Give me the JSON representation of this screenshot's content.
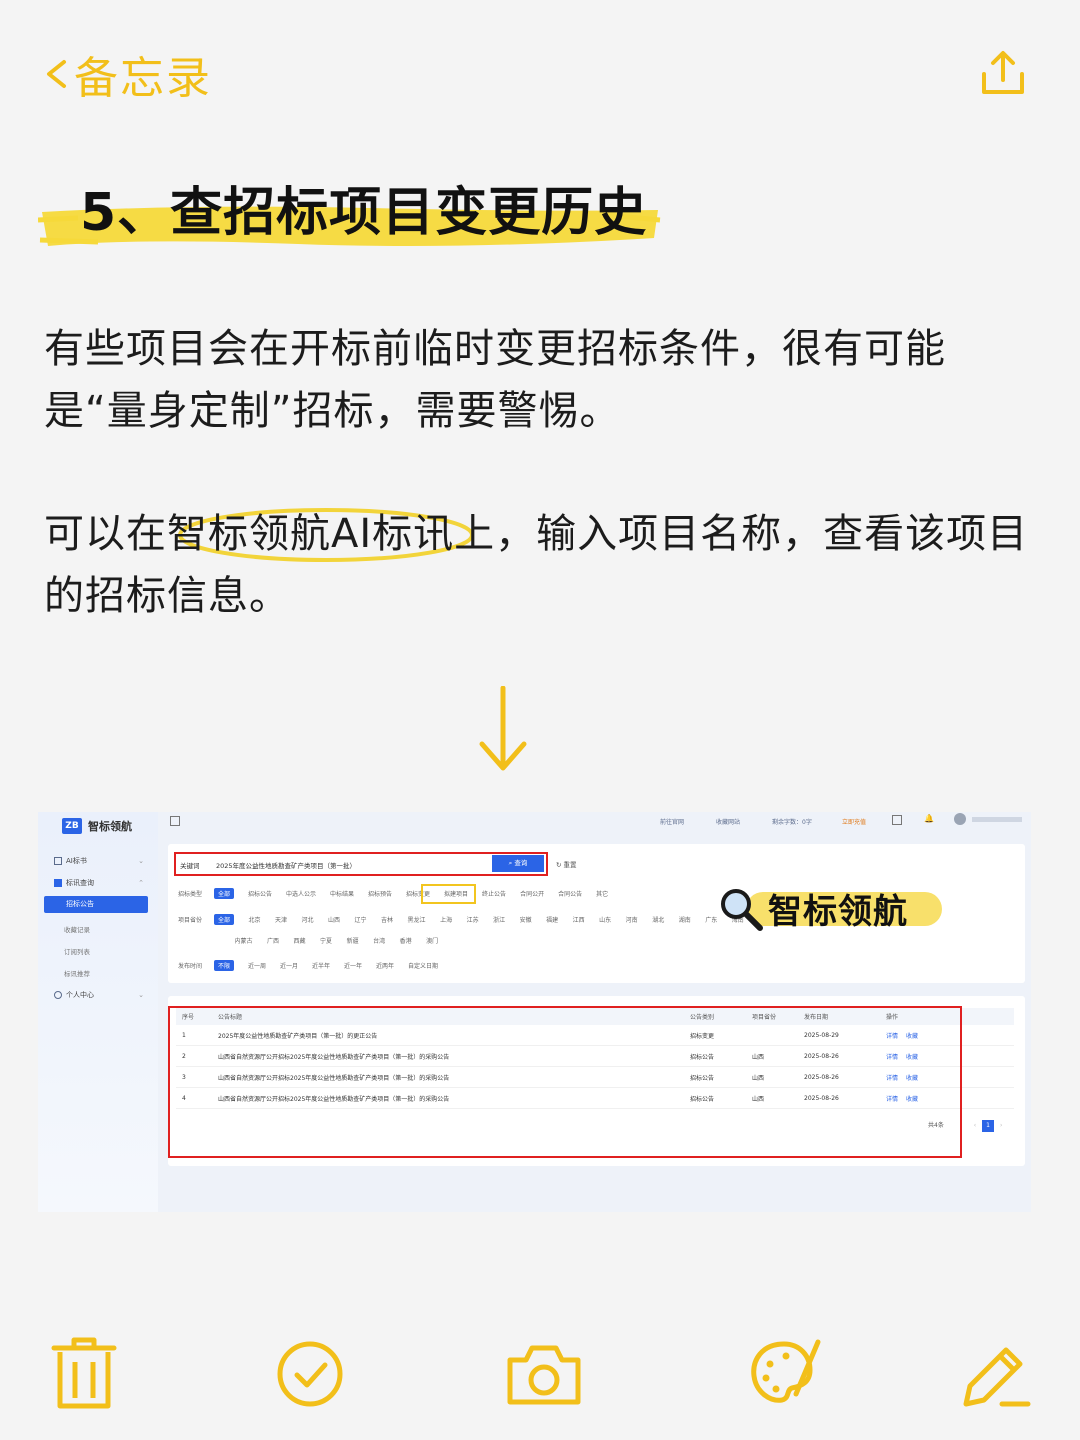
{
  "header": {
    "back_label": "备忘录"
  },
  "heading": "5、查招标项目变更历史",
  "paragraphs": [
    "有些项目会在开标前临时变更招标条件，很有可能是“量身定制”招标，需要警惕。",
    "可以在智标领航AI标讯上，输入项目名称，查看该项目的招标信息。"
  ],
  "screenshot": {
    "logo_text": "智标领航",
    "logo_mark": "ZB",
    "sidebar": {
      "items": [
        "AI标书",
        "标讯查询",
        "个人中心"
      ],
      "subitems": [
        "招标公告",
        "收藏记录",
        "订阅列表",
        "标讯推荐"
      ]
    },
    "topbar": [
      "前往官网",
      "收藏网站",
      "剩余字数：0字",
      "立即充值"
    ],
    "search": {
      "label": "关键词",
      "value": "2025年度公益性地质勘查矿产类项目（第一批）",
      "button": "查询",
      "reset": "重置"
    },
    "filters": {
      "type_label": "招标类型",
      "types": [
        "全部",
        "招标公告",
        "中选人公示",
        "中标结果",
        "招标预告",
        "招标变更",
        "拟建项目",
        "终止公告",
        "合同公开",
        "合同公告",
        "其它"
      ],
      "province_label": "项目省份",
      "provinces_row1": [
        "全部",
        "北京",
        "天津",
        "河北",
        "山西",
        "辽宁",
        "吉林",
        "黑龙江",
        "上海",
        "江苏",
        "浙江",
        "安徽",
        "福建",
        "江西",
        "山东",
        "河南",
        "湖北",
        "湖南",
        "广东",
        "海南",
        "重庆",
        "四川",
        "贵州",
        "云南",
        "陕西",
        "甘肃",
        "青海"
      ],
      "provinces_row2": [
        "内蒙古",
        "广西",
        "西藏",
        "宁夏",
        "新疆",
        "台湾",
        "香港",
        "澳门"
      ],
      "time_label": "发布时间",
      "times": [
        "不限",
        "近一周",
        "近一月",
        "近半年",
        "近一年",
        "近两年",
        "自定义日期"
      ]
    },
    "brand_overlay": "智标领航",
    "table": {
      "headers": [
        "序号",
        "公告标题",
        "公告类别",
        "项目省份",
        "发布日期",
        "操作"
      ],
      "rows": [
        [
          "1",
          "2025年度公益性地质勘查矿产类项目（第一批）的更正公告",
          "招标变更",
          "",
          "2025-08-29"
        ],
        [
          "2",
          "山西省自然资源厅公开招标2025年度公益性地质勘查矿产类项目（第一批）的采购公告",
          "招标公告",
          "山西",
          "2025-08-26"
        ],
        [
          "3",
          "山西省自然资源厅公开招标2025年度公益性地质勘查矿产类项目（第一批）的采购公告",
          "招标公告",
          "山西",
          "2025-08-26"
        ],
        [
          "4",
          "山西省自然资源厅公开招标2025年度公益性地质勘查矿产类项目（第一批）的采购公告",
          "招标公告",
          "山西",
          "2025-08-26"
        ]
      ],
      "action_detail": "详情",
      "action_fav": "收藏"
    },
    "pager": {
      "total": "共4条",
      "current": "1"
    }
  },
  "toolbar": [
    "trash-icon",
    "check-circle-icon",
    "camera-icon",
    "palette-icon",
    "compose-icon"
  ],
  "colors": {
    "accent": "#f2bf1a",
    "brand_blue": "#2b64e6",
    "red_box": "#e02020"
  }
}
